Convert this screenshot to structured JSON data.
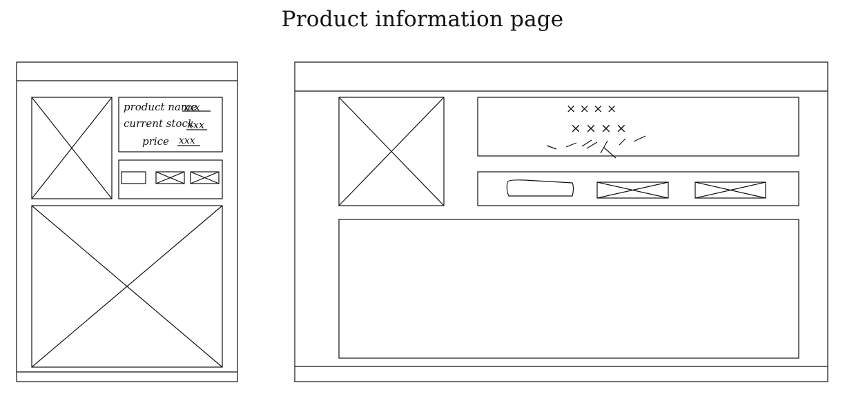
{
  "page": {
    "title": "Product information page"
  },
  "mobile_wireframe": {
    "info_box": {
      "product_name_label": "product name",
      "product_name_value": "xxx",
      "current_stock_label": "current stock",
      "current_stock_value": "xxx",
      "price_label": "price",
      "price_value": "xxx"
    }
  },
  "desktop_wireframe": {
    "info_box": {
      "line1": "× × × ×",
      "line2": "× × × ×"
    }
  }
}
